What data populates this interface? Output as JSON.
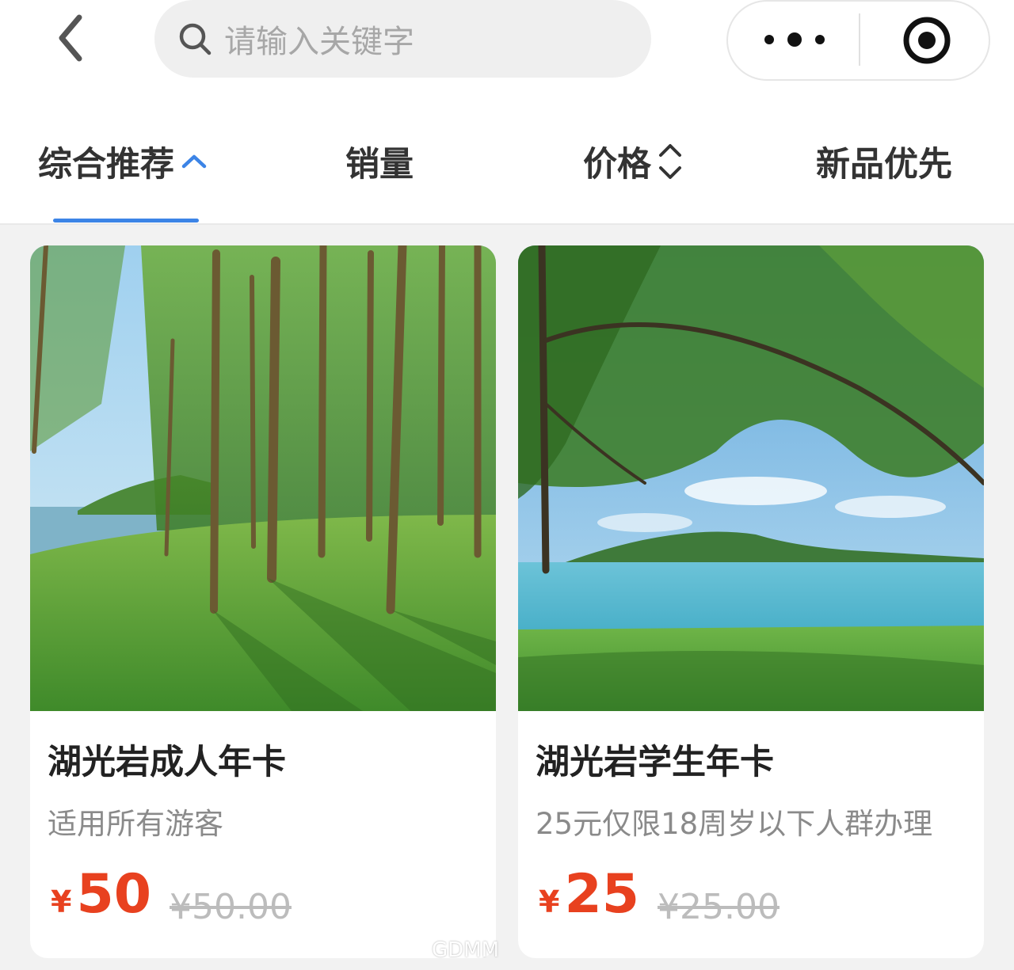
{
  "header": {
    "search_placeholder": "请输入关键字"
  },
  "icons": {
    "back": "chevron-left-icon",
    "search": "search-icon",
    "more": "more-dots-icon",
    "close": "record-circle-icon",
    "sort_up": "chevron-up-icon",
    "sort_updown": "updown-chevron-icon"
  },
  "sort_tabs": [
    {
      "label": "综合推荐",
      "active": true
    },
    {
      "label": "销量",
      "active": false
    },
    {
      "label": "价格",
      "active": false
    },
    {
      "label": "新品优先",
      "active": false
    }
  ],
  "colors": {
    "accent": "#3c84e6",
    "price": "#e8411f",
    "original_price": "#bcbcbc"
  },
  "products": [
    {
      "title": "湖光岩成人年卡",
      "desc": "适用所有游客",
      "currency": "¥",
      "price": "50",
      "original_price": "¥50.00",
      "image": "forest-lake-photo"
    },
    {
      "title": "湖光岩学生年卡",
      "desc": "25元仅限18周岁以下人群办理",
      "currency": "¥",
      "price": "25",
      "original_price": "¥25.00",
      "image": "lake-tree-photo"
    }
  ],
  "watermark": "GDMM"
}
